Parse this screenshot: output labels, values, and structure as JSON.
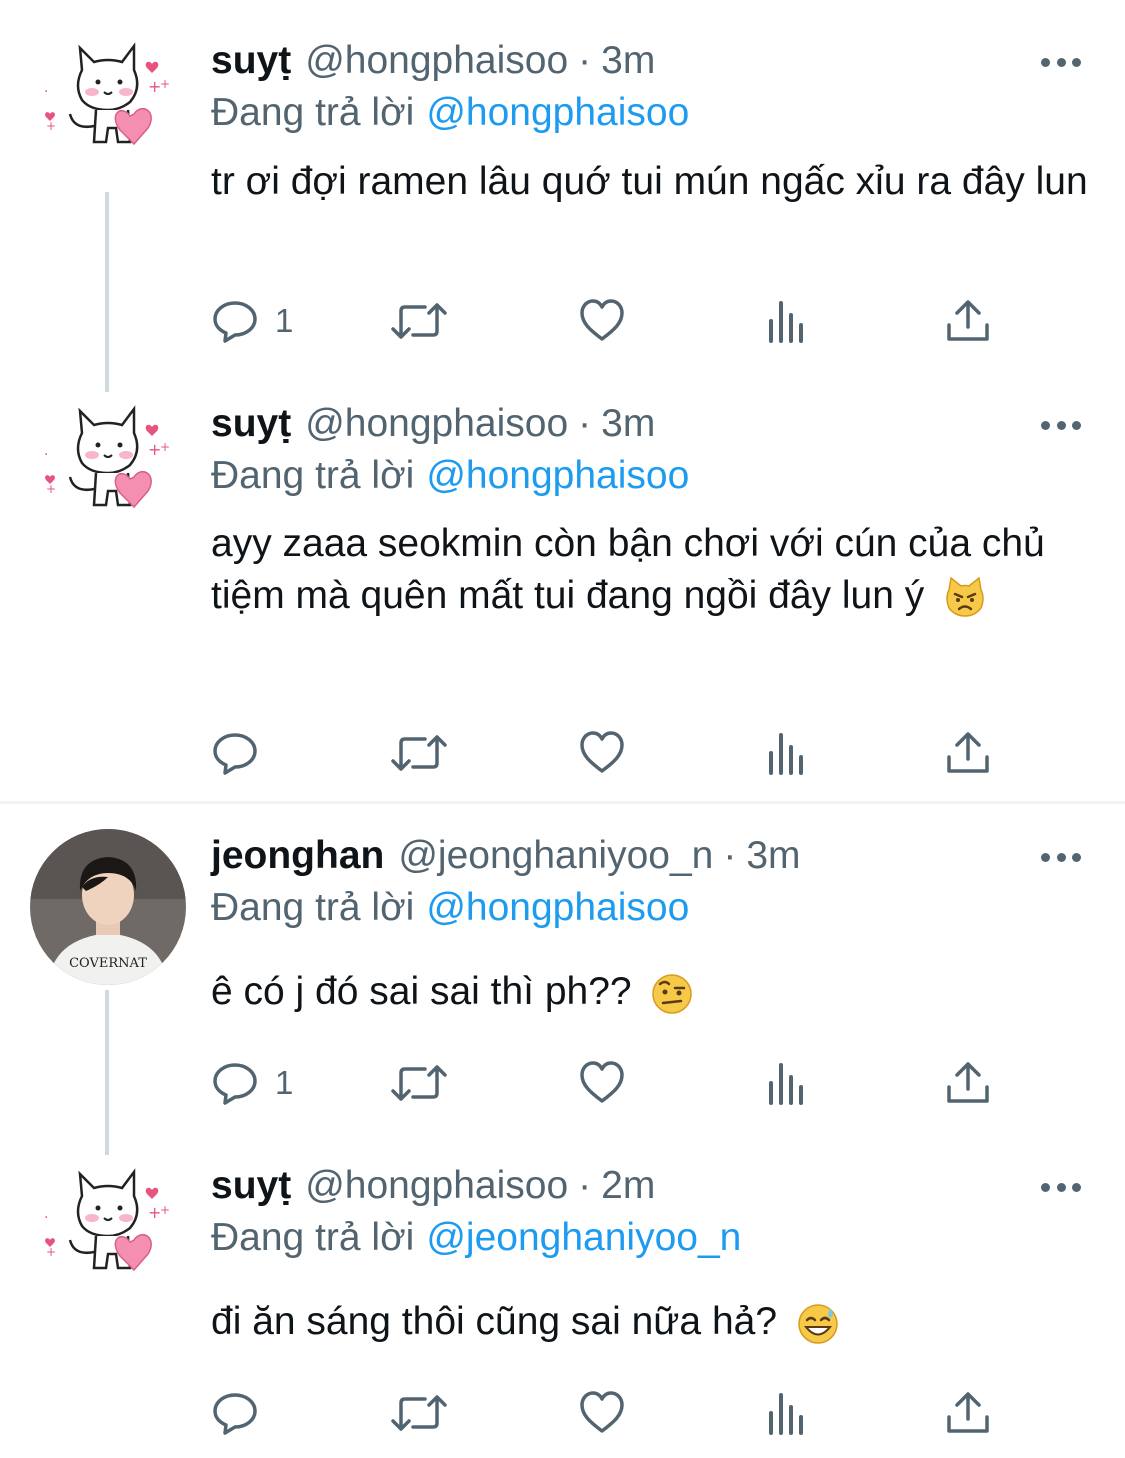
{
  "tweets": [
    {
      "name": "suyṭ",
      "handle": "@hongphaisoo",
      "sep": "·",
      "time": "3m",
      "reply_prefix": "Đang trả lời",
      "reply_to": "@hongphaisoo",
      "text": "tr ơi đợi ramen lâu quớ tui mún ngấc xỉu ra đây lun",
      "reply_count": "1",
      "avatar_icon": "cat-heart-avatar"
    },
    {
      "name": "suyṭ",
      "handle": "@hongphaisoo",
      "sep": "·",
      "time": "3m",
      "reply_prefix": "Đang trả lời",
      "reply_to": "@hongphaisoo",
      "text": "ayy zaaa seokmin còn bận chơi với cún của chủ tiệm mà quên mất tui đang ngồi đây lun ý",
      "emoji": "pouting-cat-emoji",
      "reply_count": "",
      "avatar_icon": "cat-heart-avatar"
    },
    {
      "name": "jeonghan",
      "handle": "@jeonghaniyoo_n",
      "sep": "·",
      "time": "3m",
      "reply_prefix": "Đang trả lời",
      "reply_to": "@hongphaisoo",
      "text": "ê có j đó sai sai thì ph??",
      "emoji": "raised-eyebrow-emoji",
      "reply_count": "1",
      "avatar_icon": "person-photo-avatar",
      "shirt_text": "COVERNAT"
    },
    {
      "name": "suyṭ",
      "handle": "@hongphaisoo",
      "sep": "·",
      "time": "2m",
      "reply_prefix": "Đang trả lời",
      "reply_to": "@jeonghaniyoo_n",
      "text": "đi ăn sáng thôi cũng sai nữa hả?",
      "emoji": "grinning-sweat-emoji",
      "reply_count": "",
      "avatar_icon": "cat-heart-avatar"
    }
  ],
  "colors": {
    "text": "#0f1419",
    "muted": "#536471",
    "link": "#1d9bf0",
    "line": "#cfd9de"
  }
}
